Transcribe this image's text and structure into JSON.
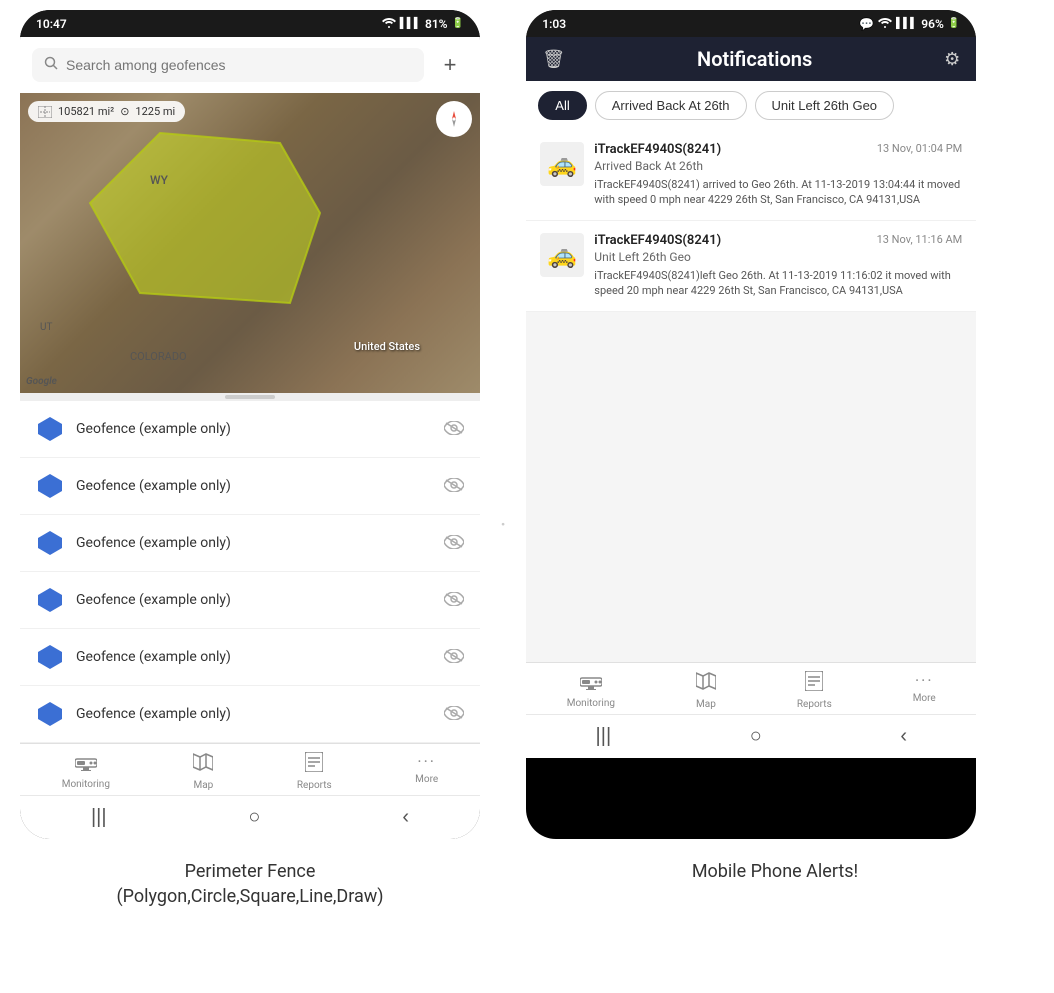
{
  "left_phone": {
    "status_bar": {
      "time": "10:47",
      "wifi": "WiFi",
      "signal": "Signal",
      "battery": "81%"
    },
    "search": {
      "placeholder": "Search among geofences",
      "add_button": "+"
    },
    "map": {
      "area_label": "105821 mi²",
      "distance_label": "1225 mi",
      "region_label": "United States",
      "state_wy": "WY",
      "state_ut": "UT",
      "state_co": "COLORADO",
      "google_label": "Google"
    },
    "geofences": [
      {
        "name": "Geofence (example only)"
      },
      {
        "name": "Geofence (example only)"
      },
      {
        "name": "Geofence (example only)"
      },
      {
        "name": "Geofence (example only)"
      },
      {
        "name": "Geofence (example only)"
      },
      {
        "name": "Geofence (example only)"
      }
    ],
    "bottom_nav": [
      {
        "label": "Monitoring",
        "icon": "🚌"
      },
      {
        "label": "Map",
        "icon": "🗺"
      },
      {
        "label": "Reports",
        "icon": "📊"
      },
      {
        "label": "More",
        "icon": "···"
      }
    ]
  },
  "right_phone": {
    "status_bar": {
      "time": "1:03",
      "battery": "96%"
    },
    "header": {
      "title": "Notifications",
      "delete_label": "🗑",
      "settings_label": "⚙"
    },
    "filter_tabs": [
      {
        "label": "All",
        "active": true
      },
      {
        "label": "Arrived Back At 26th",
        "active": false
      },
      {
        "label": "Unit Left 26th Geo",
        "active": false
      }
    ],
    "notifications": [
      {
        "device": "iTrackEF4940S(8241)",
        "time": "13 Nov, 01:04 PM",
        "event": "Arrived Back At 26th",
        "message": "iTrackEF4940S(8241) arrived to Geo 26th.   At 11-13-2019 13:04:44 it moved with speed 0 mph near 4229 26th St, San Francisco, CA 94131,USA"
      },
      {
        "device": "iTrackEF4940S(8241)",
        "time": "13 Nov, 11:16 AM",
        "event": "Unit Left 26th Geo",
        "message": "iTrackEF4940S(8241)left Geo 26th.   At 11-13-2019 11:16:02 it moved with speed 20 mph near 4229 26th St, San Francisco, CA 94131,USA"
      }
    ],
    "bottom_nav": [
      {
        "label": "Monitoring",
        "icon": "🚌"
      },
      {
        "label": "Map",
        "icon": "🗺"
      },
      {
        "label": "Reports",
        "icon": "📊"
      },
      {
        "label": "More",
        "icon": "···"
      }
    ]
  },
  "captions": {
    "left": "Perimeter Fence\n(Polygon,Circle,Square,Line,Draw)",
    "right": "Mobile Phone Alerts!"
  }
}
